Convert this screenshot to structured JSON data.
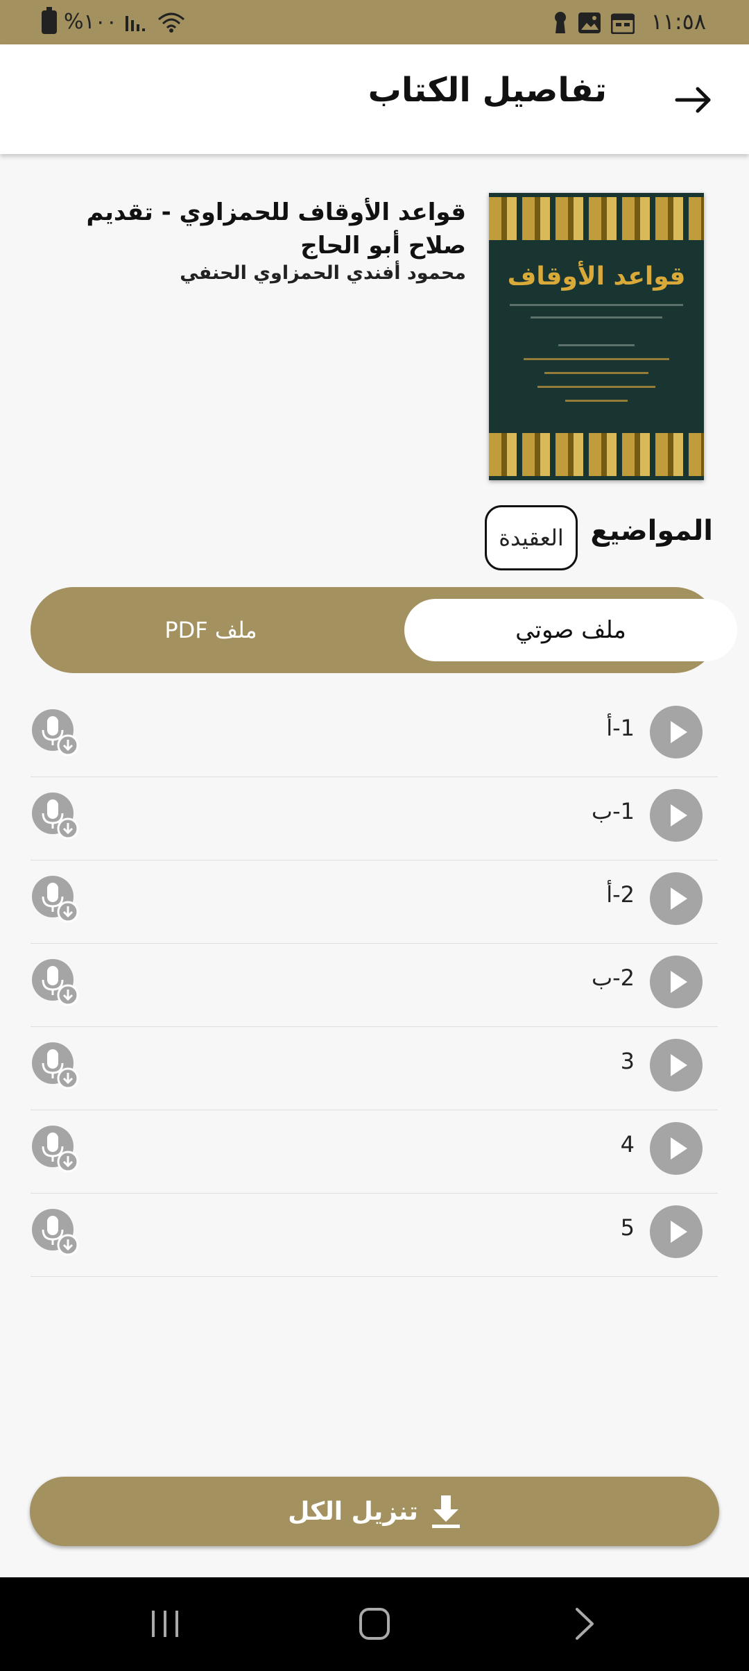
{
  "status_bar": {
    "time": "١١:٥٨",
    "battery": "%١٠٠"
  },
  "header": {
    "title": "تفاصيل الكتاب",
    "back_icon": "arrow-right-icon"
  },
  "book": {
    "title": "قواعد الأوقاف للحمزاوي - تقديم صلاح أبو الحاج",
    "author": "محمود أفندي الحمزاوي الحنفي",
    "cover_title": "قواعد الأوقاف"
  },
  "topics": {
    "label": "المواضيع :",
    "items": [
      "العقيدة"
    ]
  },
  "tabs": {
    "audio": "ملف صوتي",
    "pdf": "ملف PDF",
    "selected": "audio"
  },
  "tracks": [
    {
      "label": "1-أ"
    },
    {
      "label": "1-ب"
    },
    {
      "label": "2-أ"
    },
    {
      "label": "2-ب"
    },
    {
      "label": "3"
    },
    {
      "label": "4"
    },
    {
      "label": "5"
    }
  ],
  "download_all": {
    "label": "تنزيل الكل",
    "icon": "download-icon"
  },
  "colors": {
    "accent": "#a39160",
    "play": "#a5a5a5"
  }
}
